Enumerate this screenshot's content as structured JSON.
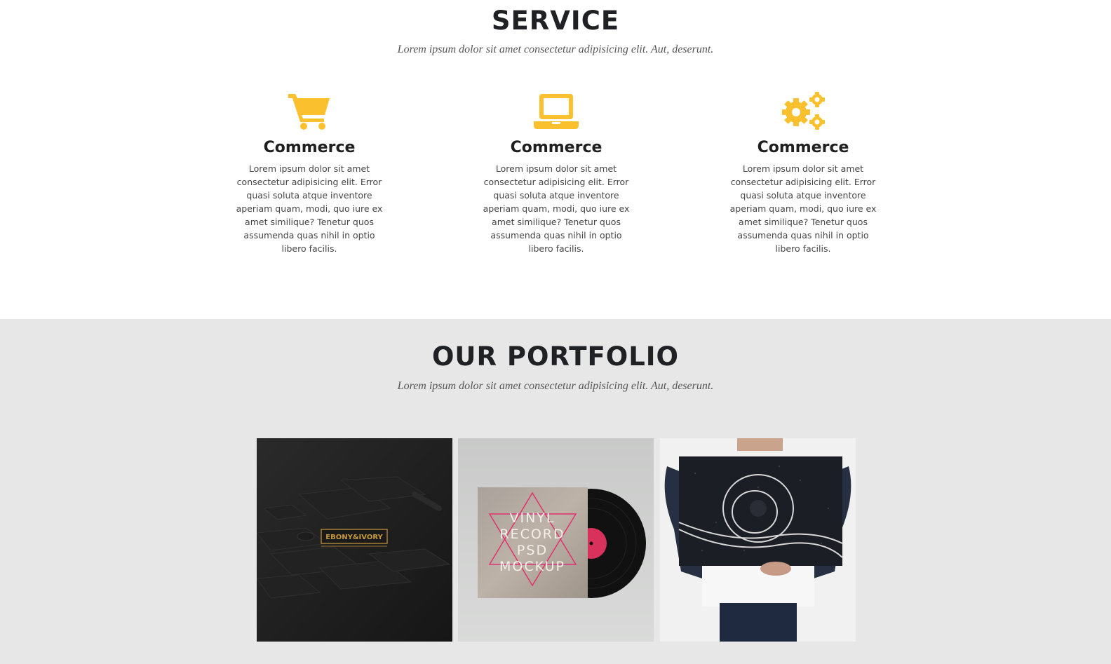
{
  "service": {
    "title": "SERVICE",
    "subtitle": "Lorem ipsum dolor sit amet consectetur adipisicing elit. Aut, deserunt.",
    "accent_color": "#fbc02d",
    "cards": [
      {
        "icon": "shopping-cart-icon",
        "title": "Commerce",
        "text": "Lorem ipsum dolor sit amet consectetur adipisicing elit. Error quasi soluta atque inventore aperiam quam, modi, quo iure ex amet similique? Tenetur quos assumenda quas nihil in optio libero facilis."
      },
      {
        "icon": "laptop-icon",
        "title": "Commerce",
        "text": "Lorem ipsum dolor sit amet consectetur adipisicing elit. Error quasi soluta atque inventore aperiam quam, modi, quo iure ex amet similique? Tenetur quos assumenda quas nihil in optio libero facilis."
      },
      {
        "icon": "gears-icon",
        "title": "Commerce",
        "text": "Lorem ipsum dolor sit amet consectetur adipisicing elit. Error quasi soluta atque inventore aperiam quam, modi, quo iure ex amet similique? Tenetur quos assumenda quas nihil in optio libero facilis."
      }
    ]
  },
  "portfolio": {
    "title": "OUR PORTFOLIO",
    "subtitle": "Lorem ipsum dolor sit amet consectetur adipisicing elit. Aut, deserunt.",
    "background_color": "#e7e7e7",
    "items": [
      {
        "name": "ebony-ivory-stationery",
        "logo_text": "EBONY&IVORY"
      },
      {
        "name": "vinyl-record-mockup",
        "cover_text": [
          "VINYL",
          "RECORD",
          "PSD",
          "MOCKUP"
        ]
      },
      {
        "name": "poster-held-mockup"
      }
    ]
  }
}
